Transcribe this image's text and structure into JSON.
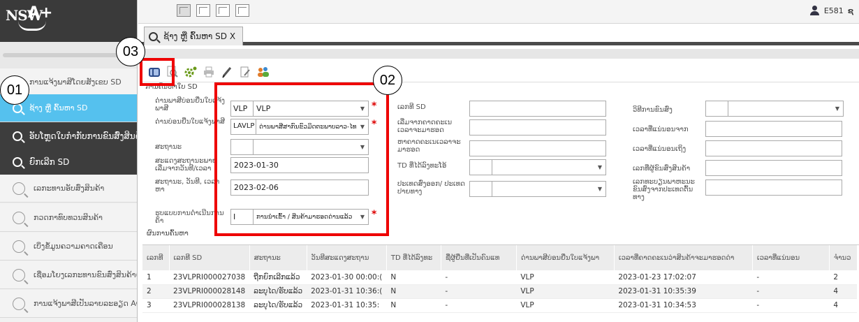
{
  "sidebar": {
    "logo_text": "NSW",
    "logo_plus": "A+",
    "items": [
      {
        "label": "ການແຈ້ງພາສີໂດຍສັງເຂບ SD",
        "style": "light"
      },
      {
        "label": "ຊ້າງ ຫຼື ຄົ້ນຫາ SD",
        "style": "active"
      },
      {
        "label": "ອັບໂຫຼດໃບກຳກັບການຂົນສົ່ງສິນຄ້າ",
        "style": "dark"
      },
      {
        "label": "ຍົກເລີກ SD",
        "style": "dark"
      },
      {
        "label": "ເລກະທານອັບສົ່ງສິນຄ້າ",
        "style": "light"
      },
      {
        "label": "ກວດກາທົບທວນສິນຄ້າ",
        "style": "light"
      },
      {
        "label": "ເບິ່ງຂໍ້ມູນຄວາມຄາດເຄືອນ",
        "style": "light"
      },
      {
        "label": "ເຊື່ອມໂຍງເລກະທານຂົນສົ່ງສິນຄ້າ(T",
        "style": "light"
      },
      {
        "label": "ການແຈ້ງພາສີເປັນລາຍລະອຽດ ACI",
        "style": "light"
      }
    ]
  },
  "topbar": {
    "user_code": "E581",
    "extra_glyph": "ຊ"
  },
  "tab": {
    "label": "ຊ້າງ ຫຼື ຄົ້ນຫາ SD X"
  },
  "form": {
    "legend": "ການຄົ້ນຫາໃບ SD",
    "col1": {
      "customs_office_label": "ດ່ານພາສີບ່ອນຍື່ນໃບແຈ້ງພາສີ",
      "customs_office_code": "VLP",
      "customs_office_value": "VLP",
      "entry_office_label": "ດ່ານບ່ອນຍື່ນໃບແຈ້ງພາສີ",
      "entry_office_code": "LAVLP",
      "entry_office_value": "ດ່ານພາສີສາກົນຂົວມິດຕະພາບລາວ-ໄທແຫ່ງທີ່",
      "status_label": "ສະຖານະ",
      "status_value": "",
      "date_from_label": "ສະແດງສະຖານະພາຍ ເລີ່ມຈາກວັນທີ/ເວລາ",
      "date_from_value": "2023-01-30",
      "date_to_label": "ສະຖານະ, ວັນທີ, ເວລາ ຫາ",
      "date_to_value": "2023-02-06",
      "declaration_type_label": "ຮູບແບບການດຳເນີນການຄ້າ",
      "declaration_type_code": "I",
      "declaration_type_value": "ການນຳເຂົ້າ / ສິນຄ້າມາຮອດດ່ານແລ້ວ"
    },
    "col2": {
      "sd_number_label": "ເລກທີ SD",
      "arrival_from_label": "ເລີ່ມຈາກຄາດຄະເນເວລາຈະມາຮອດ",
      "arrival_to_label": "ຫາຄາດຄະເນເວລາຈະມາຮອດ",
      "td_label": "TD ທີ່ໄດ້ລົງທະໂອ້",
      "country_label": "ປະເທດສົ່ງອອກ/ ປະເທດປາຍທາງ"
    },
    "col3": {
      "permit_label": "ວິທີການຂົນສົ່ງ",
      "modified_from_label": "ເວລາທີ່ແນ່ນອນຈາກ",
      "modified_to_label": "ເວລາທີ່ແນ່ນອນເຖິງ",
      "carrier_label": "ເລກທີ່ຜູ້ຂົນສົ່ງສິນຄ້າ",
      "vehicle_label": "ເລກທະບຽນພາຫະນະຂົນສົ່ງຈາກປະເທດຕົ້ນທາງ"
    }
  },
  "results": {
    "legend": "ຜົນການຄົ້ນຫາ",
    "columns": [
      "ເລກທີ",
      "ເລກທີ SD",
      "ສະຖານະ",
      "ວັນທີສະແດງສະຖານ",
      "TD ທີ່ໄດ້ລົງທະ",
      "ຊື່ຜູ້ຍື່ນທີ່ເປັນຄົນແທ",
      "ດ່ານພາສີບ່ອນຍື່ນໃບແຈ້ງພາ",
      "ເວລາທີ່ຄາດຄະເນວ່າສິນຄ້າຈະມາຮອດດ່າ",
      "ເວລາທີ່ແນ່ນອນ",
      "ຈຳນວ"
    ],
    "rows": [
      [
        "1",
        "23VLPRI000027038",
        "ຖືກຍົກເລີກແລ້ວ",
        "2023-01-30 00:00:(",
        "N",
        "-",
        "VLP",
        "2023-01-23 17:02:07",
        "-",
        "2"
      ],
      [
        "2",
        "23VLPRI000028148",
        "ລະບຸໄດ/ຮັບແລ້ວ",
        "2023-01-31 10:36:(",
        "N",
        "-",
        "VLP",
        "2023-01-31 10:35:39",
        "-",
        "4"
      ],
      [
        "3",
        "23VLPRI000028138",
        "ລະບຸໄດ/ຮັບແລ້ວ",
        "2023-01-31 10:35:",
        "N",
        "-",
        "VLP",
        "2023-01-31 10:34:53",
        "-",
        "4"
      ]
    ]
  },
  "annotations": {
    "c01": "01",
    "c02": "02",
    "c03": "03",
    "red": "#e00000"
  },
  "colors": {
    "active_item": "#55c1ee",
    "dark_item": "#3d3d3d",
    "required": "#dd0000"
  }
}
